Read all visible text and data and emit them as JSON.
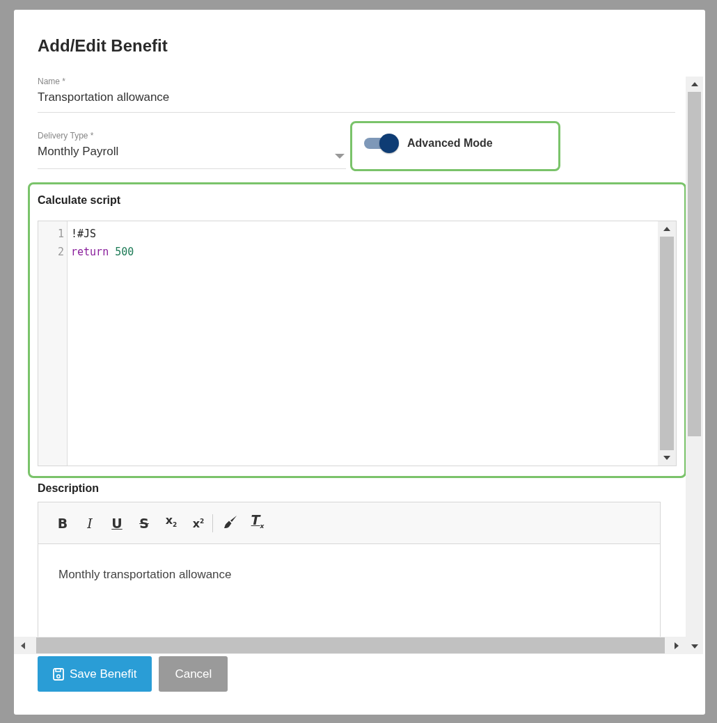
{
  "dialog": {
    "title": "Add/Edit Benefit"
  },
  "name_field": {
    "label": "Name *",
    "value": "Transportation allowance"
  },
  "delivery_type": {
    "label": "Delivery Type *",
    "value": "Monthly Payroll"
  },
  "advanced_mode": {
    "label": "Advanced Mode",
    "on": true
  },
  "script": {
    "label": "Calculate script",
    "lines": [
      {
        "number": "1",
        "tokens": [
          {
            "kind": "plain",
            "text": "!#JS"
          }
        ]
      },
      {
        "number": "2",
        "tokens": [
          {
            "kind": "keyword",
            "text": "return"
          },
          {
            "kind": "number",
            "text": "500"
          }
        ]
      }
    ]
  },
  "description": {
    "label": "Description",
    "toolbar": [
      {
        "kind": "bold",
        "glyph": "B"
      },
      {
        "kind": "italic",
        "glyph": "I"
      },
      {
        "kind": "underline",
        "glyph": "U"
      },
      {
        "kind": "strike",
        "glyph": "S"
      },
      {
        "kind": "script",
        "glyph": "x$_{2}$"
      },
      {
        "kind": "script",
        "glyph": "x$^{2}$"
      },
      {
        "kind": "separator"
      },
      {
        "kind": "brush"
      },
      {
        "kind": "clear",
        "glyph": "T$_{x}$"
      }
    ],
    "text": "Monthly transportation allowance"
  },
  "buttons": [
    {
      "kind": "primary",
      "label": "Save Benefit"
    },
    {
      "kind": "secondary",
      "label": "Cancel"
    }
  ]
}
